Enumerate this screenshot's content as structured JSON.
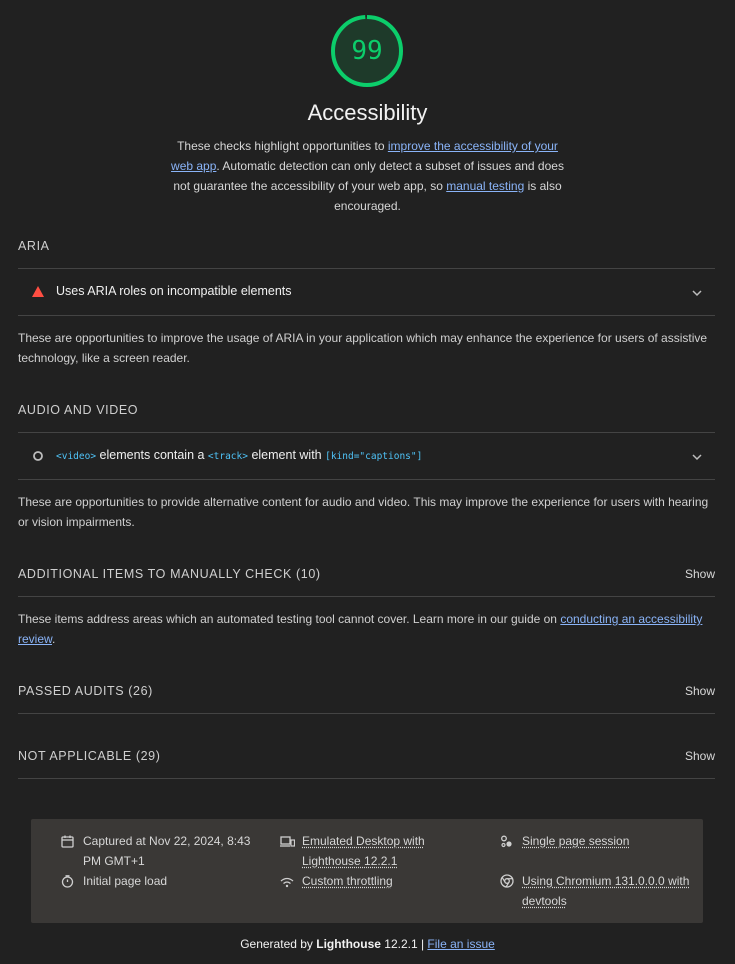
{
  "score": {
    "value": "99",
    "fraction": 0.99,
    "color": "#0cce6b"
  },
  "category": {
    "title": "Accessibility",
    "desc_before": "These checks highlight opportunities to ",
    "desc_link1": "improve the accessibility of your web app",
    "desc_mid": ". Automatic detection can only detect a subset of issues and does not guarantee the accessibility of your web app, so ",
    "desc_link2": "manual testing",
    "desc_after": " is also encouraged."
  },
  "groups": {
    "aria": {
      "title": "ARIA",
      "audit_label": "Uses ARIA roles on incompatible elements",
      "description": "These are opportunities to improve the usage of ARIA in your application which may enhance the experience for users of assistive technology, like a screen reader."
    },
    "audio_video": {
      "title": "AUDIO AND VIDEO",
      "code_video": "<video>",
      "text1": " elements contain a ",
      "code_track": "<track>",
      "text2": " element with ",
      "code_kind": "[kind=\"captions\"]",
      "description": "These are opportunities to provide alternative content for audio and video. This may improve the experience for users with hearing or vision impairments."
    },
    "manual": {
      "title": "ADDITIONAL ITEMS TO MANUALLY CHECK (10)",
      "show": "Show",
      "desc_before": "These items address areas which an automated testing tool cannot cover. Learn more in our guide on ",
      "desc_link": "conducting an accessibility review",
      "desc_after": "."
    },
    "passed": {
      "title": "PASSED AUDITS (26)",
      "show": "Show"
    },
    "not_applicable": {
      "title": "NOT APPLICABLE (29)",
      "show": "Show"
    }
  },
  "environment": {
    "captured": "Captured at Nov 22, 2024, 8:43 PM GMT+1",
    "initial_load": "Initial page load",
    "emulated": "Emulated Desktop with Lighthouse 12.2.1",
    "throttling": "Custom throttling",
    "session": "Single page session",
    "chromium": "Using Chromium 131.0.0.0 with devtools"
  },
  "footer": {
    "generated_by": "Generated by ",
    "tool": "Lighthouse",
    "version": " 12.2.1 | ",
    "file_issue": "File an issue"
  }
}
